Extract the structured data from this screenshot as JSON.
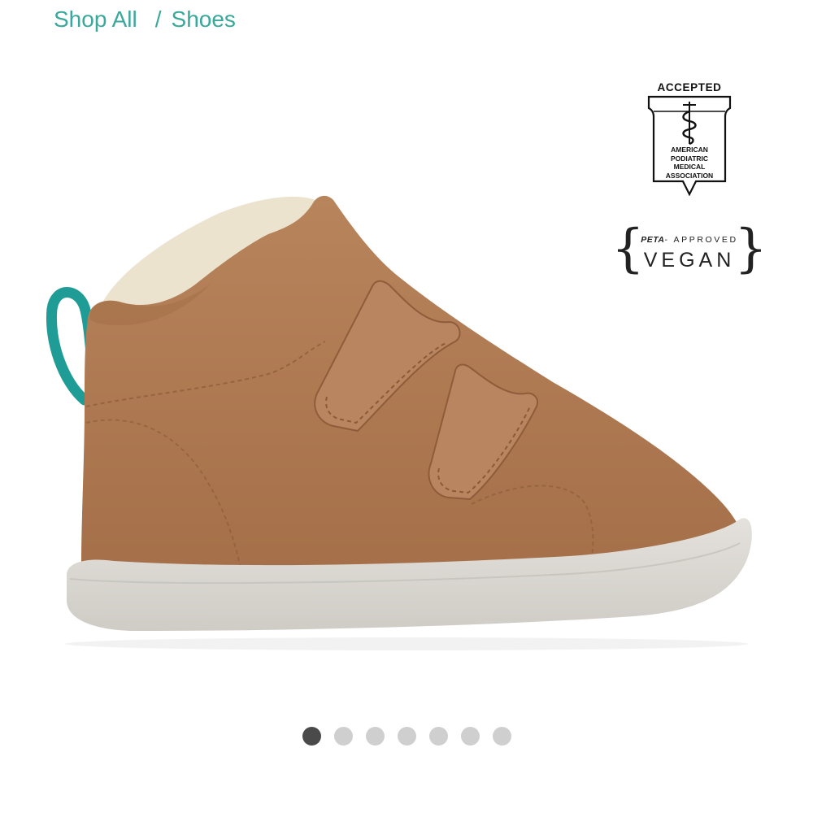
{
  "breadcrumb": {
    "items": [
      {
        "label": "Shop All"
      },
      {
        "label": "Shoes"
      }
    ],
    "separator": "/"
  },
  "product": {
    "colors": {
      "leather": "#b07a52",
      "sole": "#dcd9d4",
      "lining": "#ece3cf",
      "pull_tab": "#1f9c96"
    }
  },
  "badges": {
    "apma": {
      "top_label": "ACCEPTED",
      "lines": [
        "AMERICAN",
        "PODIATRIC",
        "MEDICAL",
        "ASSOCIATION"
      ]
    },
    "peta": {
      "brand": "PETA",
      "approved_label": "- APPROVED",
      "vegan_label": "VEGAN"
    }
  },
  "carousel": {
    "total": 7,
    "active_index": 0
  },
  "colors": {
    "breadcrumb_link": "#3aa89b",
    "dot_active": "#4a4a4a",
    "dot_inactive": "#cfcfcf"
  }
}
